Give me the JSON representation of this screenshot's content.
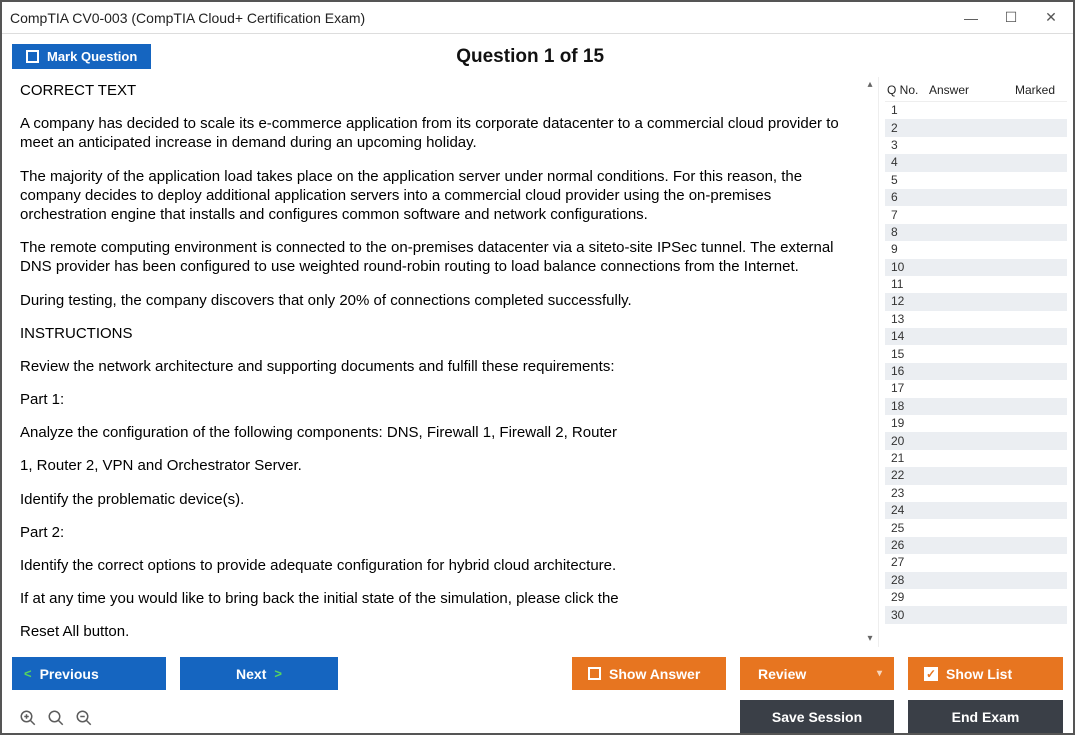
{
  "window": {
    "title": "CompTIA CV0-003 (CompTIA Cloud+ Certification Exam)"
  },
  "header": {
    "mark_label": "Mark Question",
    "counter": "Question 1 of 15"
  },
  "question": {
    "p1": "CORRECT TEXT",
    "p2": "A company has decided to scale its e-commerce application from its corporate datacenter to a commercial cloud provider to meet an anticipated increase in demand during an upcoming holiday.",
    "p3": "The majority of the application load takes place on the application server under normal conditions. For this reason, the company decides to deploy additional application servers into a commercial cloud provider using the on-premises orchestration engine that installs and configures common software and network configurations.",
    "p4": "The remote computing environment is connected to the on-premises datacenter via a siteto-site IPSec tunnel. The external DNS provider has been configured to use weighted round-robin routing to load balance connections from the Internet.",
    "p5": "During testing, the company discovers that only 20% of connections completed successfully.",
    "p6": "INSTRUCTIONS",
    "p7": "Review the network architecture and supporting documents and fulfill these requirements:",
    "p8": "Part 1:",
    "p9": "Analyze the configuration of the following components: DNS, Firewall 1, Firewall 2, Router",
    "p10": "1, Router 2, VPN and Orchestrator Server.",
    "p11": "Identify the problematic device(s).",
    "p12": "Part 2:",
    "p13": "Identify the correct options to provide adequate configuration for hybrid cloud architecture.",
    "p14": "If at any time you would like to bring back the initial state of the simulation, please click the",
    "p15": "Reset All button."
  },
  "sidepanel": {
    "h_qno": "Q No.",
    "h_answer": "Answer",
    "h_marked": "Marked",
    "rows": 30
  },
  "footer": {
    "previous": "Previous",
    "next": "Next",
    "show_answer": "Show Answer",
    "review": "Review",
    "show_list": "Show List",
    "save_session": "Save Session",
    "end_exam": "End Exam"
  }
}
